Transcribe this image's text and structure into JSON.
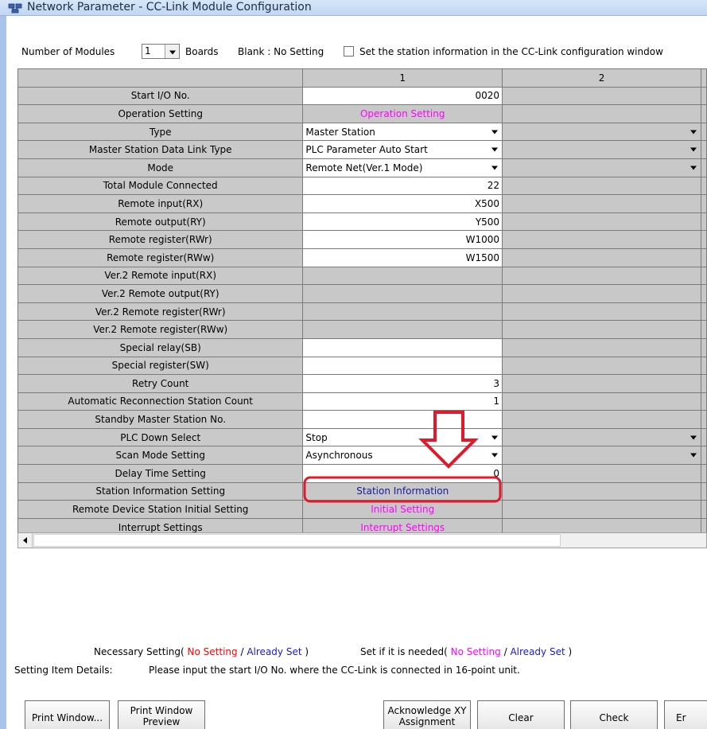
{
  "window": {
    "title": "Network Parameter - CC-Link Module Configuration"
  },
  "topbar": {
    "modules_label": "Number of Modules",
    "modules_value": "1",
    "boards_label": "Boards",
    "blank_label": "Blank : No Setting",
    "station_checkbox_label": "Set the station information in the CC-Link configuration window"
  },
  "grid": {
    "columns": [
      "1",
      "2"
    ],
    "rows": [
      {
        "label": "Start I/O No.",
        "value": "0020"
      },
      {
        "label": "Operation Setting",
        "value": "Operation Setting"
      },
      {
        "label": "Type",
        "value": "Master Station"
      },
      {
        "label": "Master Station Data Link Type",
        "value": "PLC Parameter Auto Start"
      },
      {
        "label": "Mode",
        "value": "Remote Net(Ver.1 Mode)"
      },
      {
        "label": "Total Module Connected",
        "value": "22"
      },
      {
        "label": "Remote input(RX)",
        "value": "X500"
      },
      {
        "label": "Remote output(RY)",
        "value": "Y500"
      },
      {
        "label": "Remote register(RWr)",
        "value": "W1000"
      },
      {
        "label": "Remote register(RWw)",
        "value": "W1500"
      },
      {
        "label": "Ver.2 Remote input(RX)",
        "value": ""
      },
      {
        "label": "Ver.2 Remote output(RY)",
        "value": ""
      },
      {
        "label": "Ver.2 Remote register(RWr)",
        "value": ""
      },
      {
        "label": "Ver.2 Remote register(RWw)",
        "value": ""
      },
      {
        "label": "Special relay(SB)",
        "value": ""
      },
      {
        "label": "Special register(SW)",
        "value": ""
      },
      {
        "label": "Retry Count",
        "value": "3"
      },
      {
        "label": "Automatic Reconnection Station Count",
        "value": "1"
      },
      {
        "label": "Standby Master Station No.",
        "value": ""
      },
      {
        "label": "PLC Down Select",
        "value": "Stop"
      },
      {
        "label": "Scan Mode Setting",
        "value": "Asynchronous"
      },
      {
        "label": "Delay Time Setting",
        "value": "0"
      },
      {
        "label": "Station Information Setting",
        "value": "Station Information"
      },
      {
        "label": "Remote Device Station Initial Setting",
        "value": "Initial Setting"
      },
      {
        "label": "Interrupt Settings",
        "value": "Interrupt Settings"
      }
    ]
  },
  "legend": {
    "necessary_prefix": "Necessary Setting(",
    "no_setting": "No Setting",
    "slash": "/",
    "already_set": "Already Set",
    "close": ")",
    "if_needed_prefix": "Set if it is needed("
  },
  "details": {
    "label": "Setting Item Details:",
    "text": "Please input the start I/O No. where the CC-Link is connected in 16-point unit."
  },
  "buttons": {
    "print_window": "Print Window...",
    "print_preview_1": "Print Window",
    "print_preview_2": "Preview",
    "ack_xy_1": "Acknowledge XY",
    "ack_xy_2": "Assignment",
    "clear": "Clear",
    "check": "Check",
    "end": "Er"
  },
  "colors": {
    "no_setting": "#ff0000",
    "already_set": "#1a1ad0",
    "optional_no_setting": "#ff00ff",
    "highlight": "#e0192b"
  }
}
